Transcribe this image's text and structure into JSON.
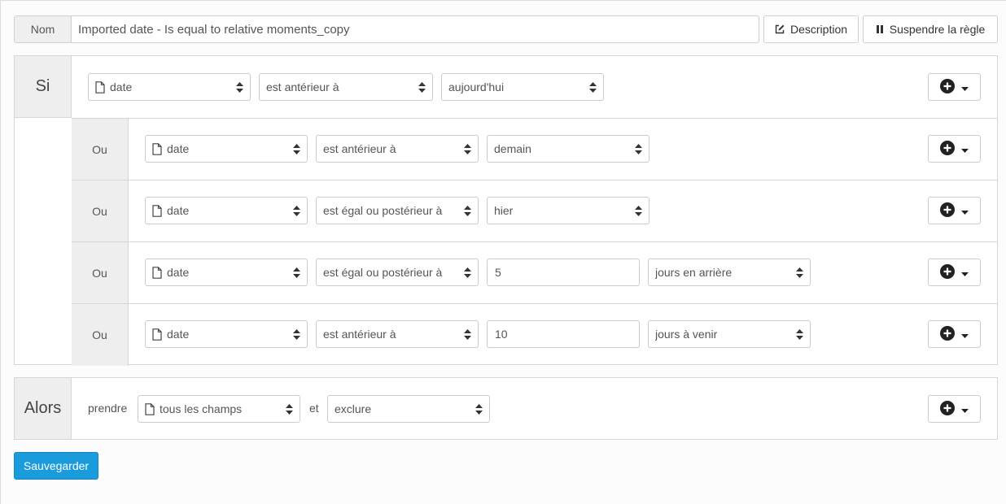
{
  "header": {
    "name_label": "Nom",
    "name_value": "Imported date - Is equal to relative moments_copy",
    "description_label": "Description",
    "suspend_label": "Suspendre la règle"
  },
  "si_block": {
    "label": "Si",
    "field": "date",
    "operator": "est antérieur à",
    "value": "aujourd'hui"
  },
  "ou_rows": [
    {
      "label": "Ou",
      "field": "date",
      "operator": "est antérieur à",
      "value": "demain"
    },
    {
      "label": "Ou",
      "field": "date",
      "operator": "est égal ou postérieur à",
      "value": "hier"
    },
    {
      "label": "Ou",
      "field": "date",
      "operator": "est égal ou postérieur à",
      "amount": "5",
      "unit": "jours en arrière"
    },
    {
      "label": "Ou",
      "field": "date",
      "operator": "est antérieur à",
      "amount": "10",
      "unit": "jours à venir"
    }
  ],
  "alors_block": {
    "label": "Alors",
    "take_label": "prendre",
    "fields": "tous les champs",
    "and_label": "et",
    "action": "exclure"
  },
  "save_label": "Sauvegarder",
  "colors": {
    "primary": "#1a9bdc",
    "side_panel": "#eeeeee",
    "border": "#d6d6d6"
  },
  "icons": {
    "field": "file-outline-icon",
    "select": "sort-caret-icon",
    "add": "plus-circle-icon",
    "dropdown": "caret-down-icon",
    "edit": "edit-square-icon",
    "pause": "pause-icon"
  }
}
